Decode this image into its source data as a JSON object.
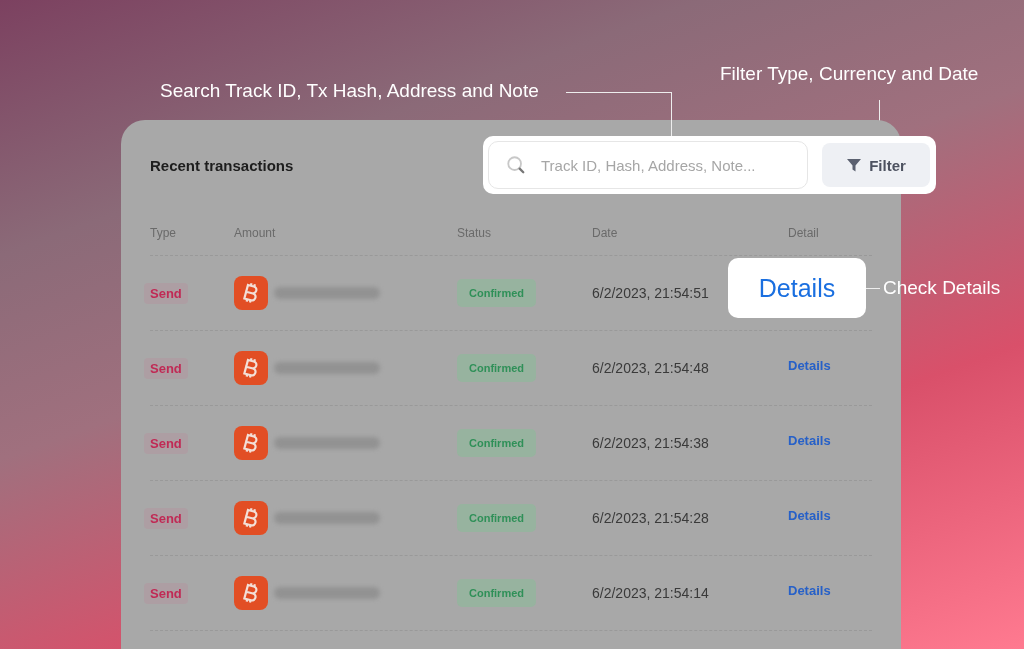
{
  "callouts": {
    "search": "Search Track ID, Tx Hash, Address and Note",
    "filter": "Filter Type, Currency and Date",
    "details": "Check Details"
  },
  "card": {
    "title": "Recent transactions",
    "search": {
      "placeholder": "Track ID, Hash, Address, Note..."
    },
    "filter_button": "Filter",
    "columns": [
      "Type",
      "Amount",
      "Status",
      "Date",
      "Detail"
    ],
    "rows": [
      {
        "type": "Send",
        "status": "Confirmed",
        "date": "6/2/2023, 21:54:51",
        "detail": "Details",
        "highlighted": true
      },
      {
        "type": "Send",
        "status": "Confirmed",
        "date": "6/2/2023, 21:54:48",
        "detail": "Details",
        "highlighted": false
      },
      {
        "type": "Send",
        "status": "Confirmed",
        "date": "6/2/2023, 21:54:38",
        "detail": "Details",
        "highlighted": false
      },
      {
        "type": "Send",
        "status": "Confirmed",
        "date": "6/2/2023, 21:54:28",
        "detail": "Details",
        "highlighted": false
      },
      {
        "type": "Send",
        "status": "Confirmed",
        "date": "6/2/2023, 21:54:14",
        "detail": "Details",
        "highlighted": false
      }
    ]
  }
}
